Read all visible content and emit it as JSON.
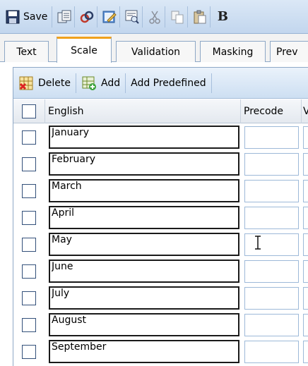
{
  "toolbar": {
    "save_label": "Save",
    "buttons": [
      {
        "name": "copy-icon"
      },
      {
        "name": "link-icon"
      },
      {
        "name": "edit-icon"
      },
      {
        "name": "preview-icon"
      },
      {
        "name": "cut-icon"
      },
      {
        "name": "copy-doc-icon"
      },
      {
        "name": "paste-icon"
      },
      {
        "name": "bold-icon",
        "glyph": "B"
      }
    ]
  },
  "tabs": [
    {
      "label": "Text"
    },
    {
      "label": "Scale",
      "active": true
    },
    {
      "label": "Validation"
    },
    {
      "label": "Masking"
    },
    {
      "label": "Prev"
    }
  ],
  "grid_toolbar": {
    "delete_label": "Delete",
    "add_label": "Add",
    "add_predefined_label": "Add Predefined"
  },
  "columns": {
    "english": "English",
    "precode": "Precode",
    "extra": "V"
  },
  "rows": [
    {
      "english": "January",
      "precode": ""
    },
    {
      "english": "February",
      "precode": ""
    },
    {
      "english": "March",
      "precode": ""
    },
    {
      "english": "April",
      "precode": ""
    },
    {
      "english": "May",
      "precode": ""
    },
    {
      "english": "June",
      "precode": ""
    },
    {
      "english": "July",
      "precode": ""
    },
    {
      "english": "August",
      "precode": ""
    },
    {
      "english": "September",
      "precode": ""
    }
  ],
  "colors": {
    "accent_tab": "#f0a11d",
    "toolbar_blue": "#c2d6ee",
    "input_border": "#9db9d8"
  }
}
